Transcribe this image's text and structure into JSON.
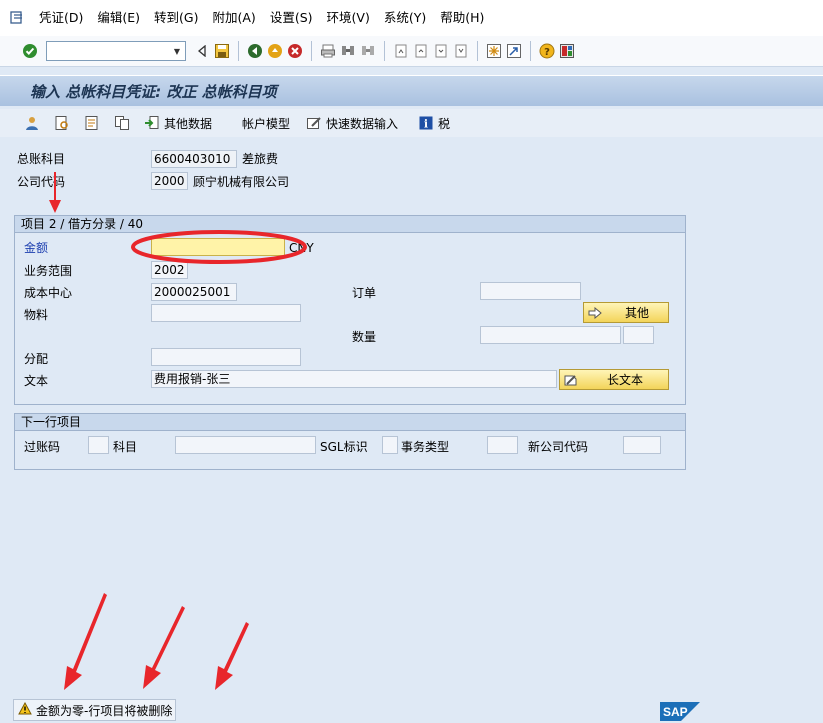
{
  "menu": [
    "凭证(D)",
    "编辑(E)",
    "转到(G)",
    "附加(A)",
    "设置(S)",
    "环境(V)",
    "系统(Y)",
    "帮助(H)"
  ],
  "command_field": {
    "value": ""
  },
  "title": "输入 总帐科目凭证: 改正 总帐科目项",
  "app_toolbar": {
    "other_data": "其他数据",
    "account_model": "帐户模型",
    "fast_entry": "快速数据输入",
    "tax": "税"
  },
  "header": {
    "gl_account_label": "总账科目",
    "gl_account_value": "6600403010",
    "gl_account_text": "差旅费",
    "company_code_label": "公司代码",
    "company_code_value": "2000",
    "company_code_text": "顾宁机械有限公司"
  },
  "item_group": {
    "title": "项目 2 / 借方分录 / 40",
    "amount_label": "金额",
    "amount_value": "",
    "currency": "CNY",
    "business_area_label": "业务范围",
    "business_area_value": "2002",
    "cost_center_label": "成本中心",
    "cost_center_value": "2000025001",
    "order_label": "订单",
    "order_value": "",
    "material_label": "物料",
    "material_value": "",
    "other_button": "其他",
    "quantity_label": "数量",
    "quantity_value": "",
    "quantity_unit": "",
    "assignment_label": "分配",
    "assignment_value": "",
    "text_label": "文本",
    "text_value": "费用报销-张三",
    "long_text_button": "长文本"
  },
  "next_item": {
    "title": "下一行项目",
    "posting_key_label": "过账码",
    "posting_key_value": "",
    "account_label": "科目",
    "account_value": "",
    "sgl_label": "SGL标识",
    "sgl_value": "",
    "transaction_type_label": "事务类型",
    "transaction_type_value": "",
    "new_company_label": "新公司代码",
    "new_company_value": ""
  },
  "status": {
    "message": "金额为零-行项目将被删除"
  },
  "logo_text": "SAP",
  "colors": {
    "title_bar": "#a9c1e0",
    "annotation_red": "#e8262b",
    "button_yellow": "#f3d45a"
  }
}
